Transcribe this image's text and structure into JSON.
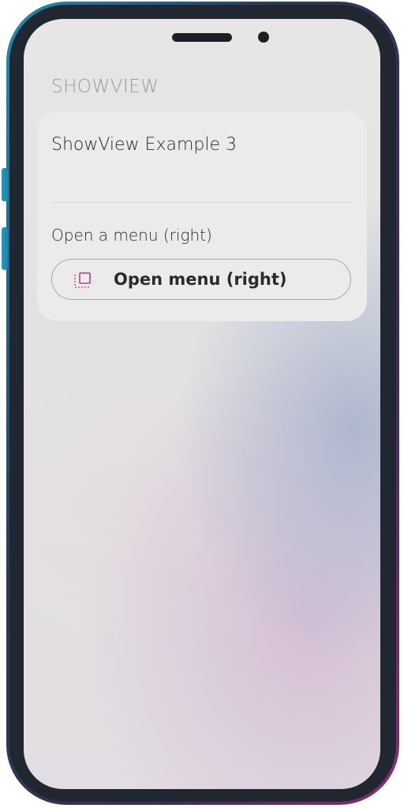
{
  "device": {
    "frame_colors": [
      "#1f8fb0",
      "#3a2f52",
      "#8a2c7a"
    ],
    "icons": [
      "speaker-icon",
      "camera-icon"
    ]
  },
  "section": {
    "title": "SHOWVIEW"
  },
  "card": {
    "title": "ShowView Example 3",
    "row_label": "Open a menu (right)",
    "button": {
      "label": "Open menu (right)",
      "icon": "menu-panel-icon",
      "icon_color": "#c23a8e"
    }
  }
}
